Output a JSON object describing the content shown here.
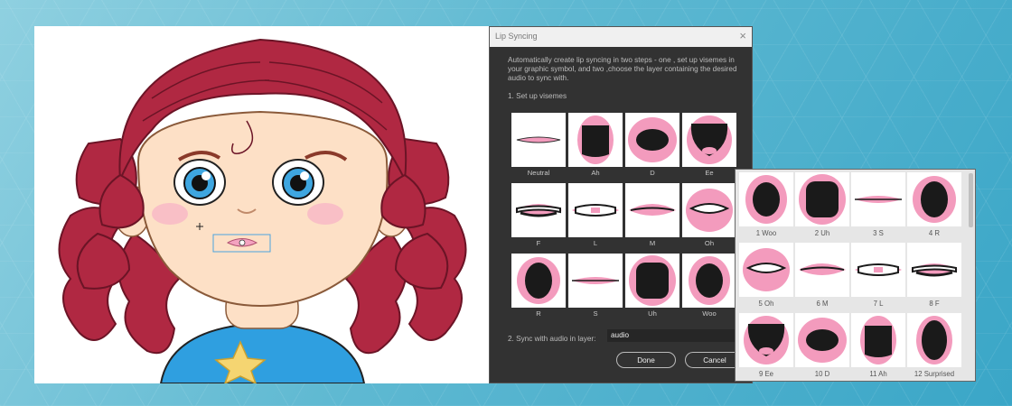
{
  "dialog": {
    "title": "Lip Syncing",
    "close_glyph": "×",
    "description": "Automatically create lip syncing in two steps - one , set up visemes in your graphic symbol, and two ,choose the layer containing the desired audio to sync with.",
    "step1_label": "1. Set up visemes",
    "visemes": [
      {
        "label": "Neutral",
        "mouth": "neutral"
      },
      {
        "label": "Ah",
        "mouth": "ah"
      },
      {
        "label": "D",
        "mouth": "d"
      },
      {
        "label": "Ee",
        "mouth": "ee"
      },
      {
        "label": "F",
        "mouth": "f"
      },
      {
        "label": "L",
        "mouth": "l"
      },
      {
        "label": "M",
        "mouth": "m"
      },
      {
        "label": "Oh",
        "mouth": "oh"
      },
      {
        "label": "R",
        "mouth": "r"
      },
      {
        "label": "S",
        "mouth": "s"
      },
      {
        "label": "Uh",
        "mouth": "uh"
      },
      {
        "label": "Woo",
        "mouth": "woo"
      }
    ],
    "step2_label": "2. Sync with audio in layer:",
    "audio_layer_value": "audio",
    "done_label": "Done",
    "cancel_label": "Cancel"
  },
  "panel": {
    "items": [
      {
        "label": "1 Woo",
        "mouth": "woo"
      },
      {
        "label": "2 Uh",
        "mouth": "uh"
      },
      {
        "label": "3 S",
        "mouth": "s"
      },
      {
        "label": "4 R",
        "mouth": "r"
      },
      {
        "label": "5 Oh",
        "mouth": "oh"
      },
      {
        "label": "6 M",
        "mouth": "m"
      },
      {
        "label": "7 L",
        "mouth": "l"
      },
      {
        "label": "8 F",
        "mouth": "f"
      },
      {
        "label": "9 Ee",
        "mouth": "ee"
      },
      {
        "label": "10 D",
        "mouth": "d"
      },
      {
        "label": "11 Ah",
        "mouth": "ah"
      },
      {
        "label": "12 Surprised",
        "mouth": "surprised"
      }
    ]
  },
  "colors": {
    "hair": "#b02842",
    "skin": "#fde0c6",
    "lips": "#f4a3c0",
    "mouth_pink": "#f39bbd",
    "mouth_dark": "#1a1a1a",
    "shirt": "#2f9fe0",
    "star": "#f5d571",
    "eye": "#3ea6e0",
    "selection": "#4aa3df"
  }
}
